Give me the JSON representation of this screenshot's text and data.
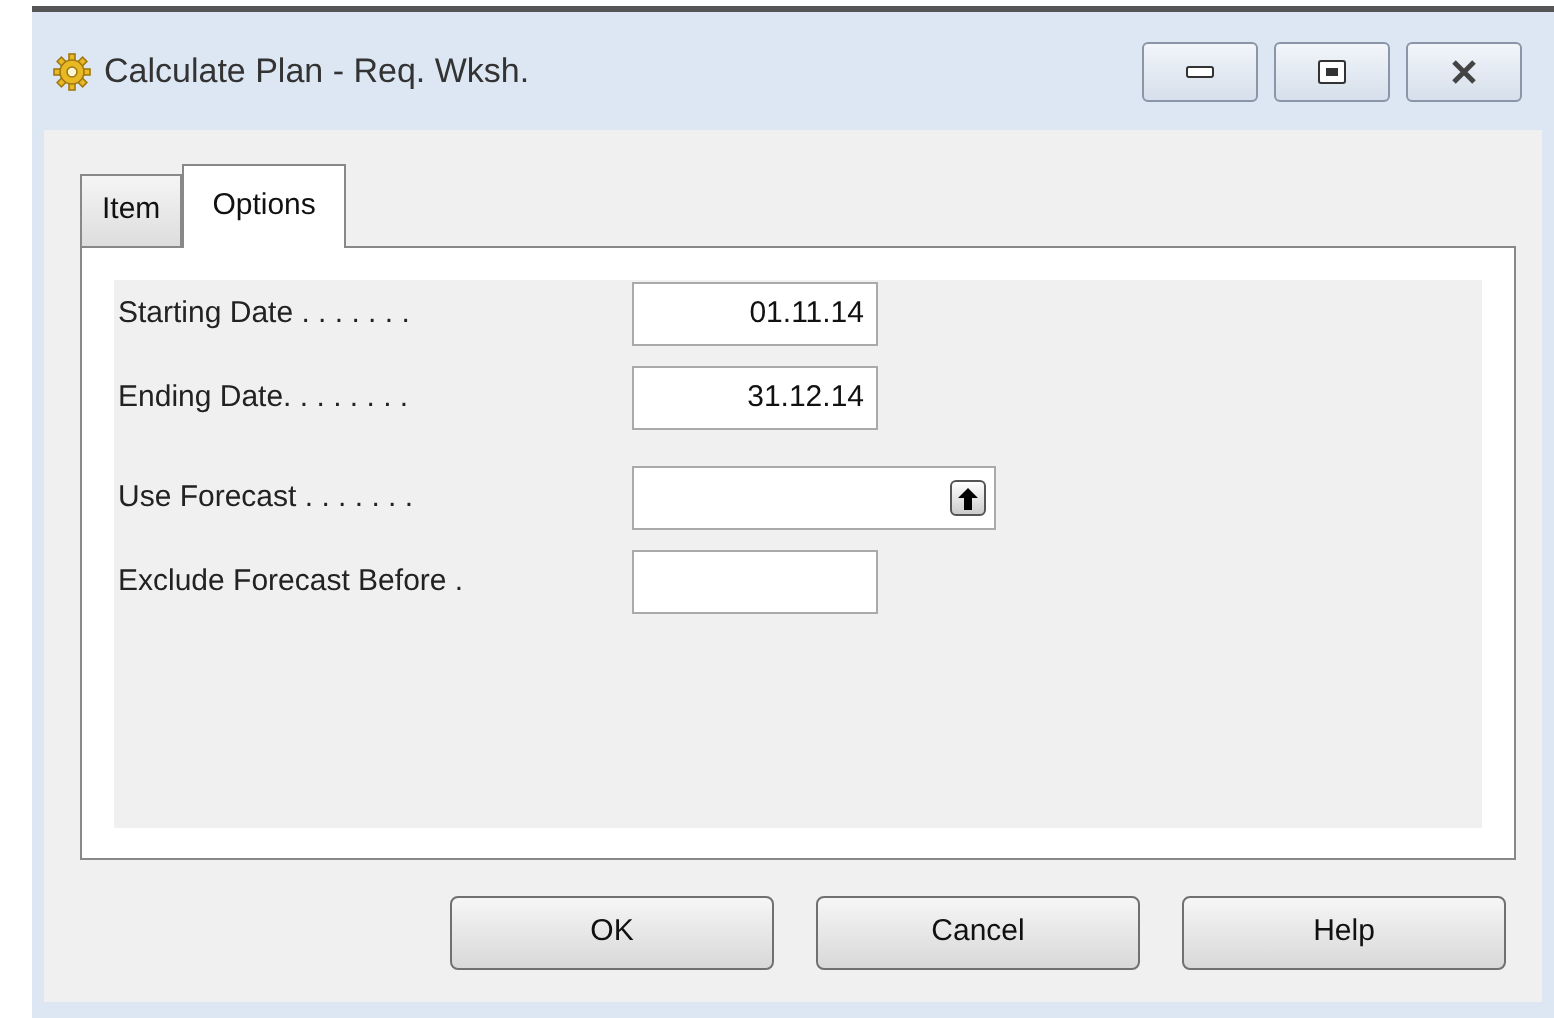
{
  "window": {
    "title": "Calculate Plan - Req. Wksh."
  },
  "tabs": [
    {
      "label": "Item",
      "selected": false
    },
    {
      "label": "Options",
      "selected": true
    }
  ],
  "fields": [
    {
      "label": "Starting Date . . . . . . .",
      "value": "01.11.14",
      "kind": "text"
    },
    {
      "label": "Ending Date. . . . . . . .",
      "value": "31.12.14",
      "kind": "text"
    },
    {
      "label": "Use Forecast . . . . . . .",
      "kind": "lookup"
    },
    {
      "label": "Exclude Forecast Before .",
      "kind": "text"
    }
  ],
  "buttons": [
    "OK",
    "Cancel",
    "Help"
  ]
}
